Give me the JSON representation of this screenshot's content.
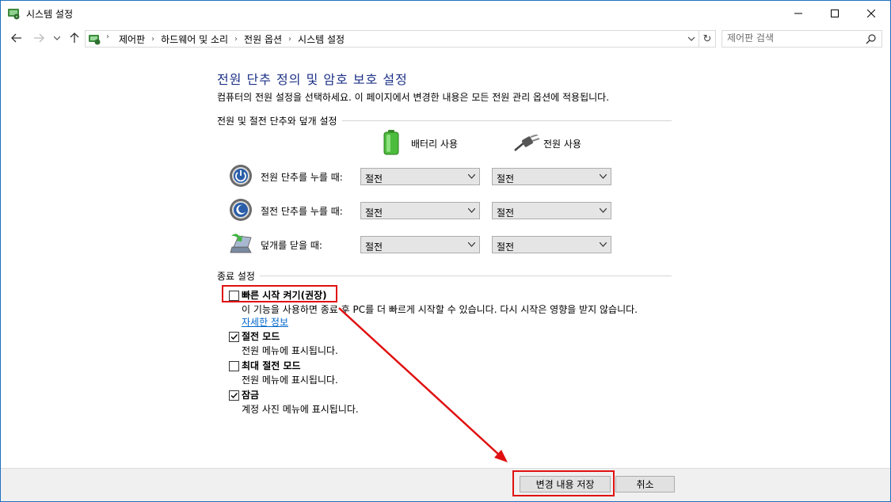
{
  "window": {
    "title": "시스템 설정",
    "icon": "power-options-icon",
    "controls": [
      "minimize-icon",
      "maximize-icon",
      "close-icon"
    ]
  },
  "address_bar": {
    "breadcrumbs": [
      "제어판",
      "하드웨어 및 소리",
      "전원 옵션",
      "시스템 설정"
    ],
    "search_placeholder": "제어판 검색"
  },
  "content": {
    "title": "전원 단추 정의 및 암호 보호 설정",
    "description": "컴퓨터의 전원 설정을 선택하세요. 이 페이지에서 변경한 내용은 모든 전원 관리 옵션에 적용됩니다.",
    "power_section": {
      "label": "전원 및 절전 단추와 덮개 설정",
      "battery_label": "배터리 사용",
      "plugged_label": "전원 사용",
      "rows": [
        {
          "label": "전원 단추를 누를 때:",
          "battery": "절전",
          "plugged": "절전"
        },
        {
          "label": "절전 단추를 누를 때:",
          "battery": "절전",
          "plugged": "절전"
        },
        {
          "label": "덮개를 닫을 때:",
          "battery": "절전",
          "plugged": "절전"
        }
      ]
    },
    "shutdown_section": {
      "label": "종료 설정",
      "fast_startup": {
        "label": "빠른 시작 켜기(권장)",
        "checked": false,
        "desc": "이 기능을 사용하면 종료 후 PC를 더 빠르게 시작할 수 있습니다. 다시 시작은 영향을 받지 않습니다.",
        "link": "자세한 정보"
      },
      "sleep": {
        "label": "절전 모드",
        "checked": true,
        "desc": "전원 메뉴에 표시됩니다."
      },
      "hibernate": {
        "label": "최대 절전 모드",
        "checked": false,
        "desc": "전원 메뉴에 표시됩니다."
      },
      "lock": {
        "label": "잠금",
        "checked": true,
        "desc": "계정 사진 메뉴에 표시됩니다."
      }
    }
  },
  "footer": {
    "save_label": "변경 내용 저장",
    "cancel_label": "취소"
  },
  "annotation": {
    "color": "#e01010"
  }
}
